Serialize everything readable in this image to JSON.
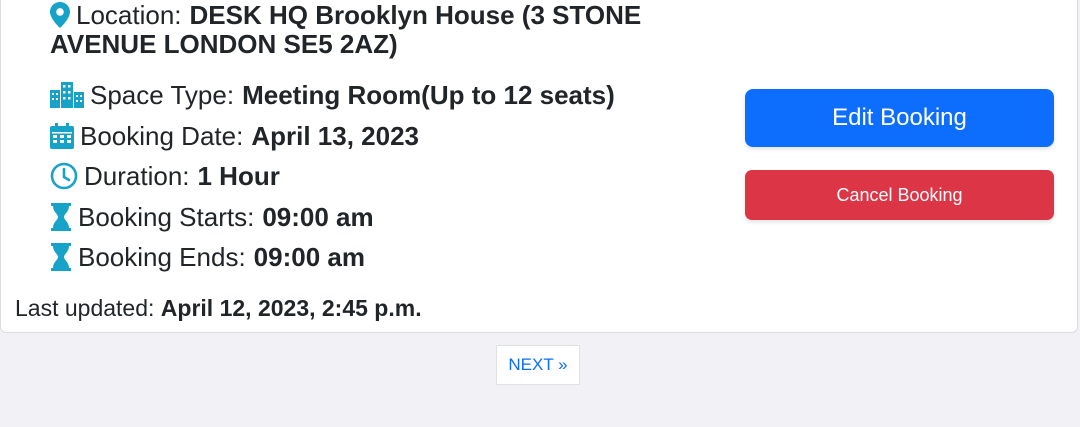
{
  "booking": {
    "location": {
      "icon": "map-pin-icon",
      "label": "Location:",
      "value_line1": "DESK HQ Brooklyn House (3 STONE",
      "value_line2": "AVENUE LONDON SE5 2AZ)"
    },
    "space_type": {
      "icon": "city-buildings-icon",
      "label": "Space Type:",
      "value": "Meeting Room(Up to 12 seats)"
    },
    "booking_date": {
      "icon": "calendar-icon",
      "label": "Booking Date:",
      "value": "April 13, 2023"
    },
    "duration": {
      "icon": "clock-icon",
      "label": "Duration:",
      "value": "1 Hour"
    },
    "starts": {
      "icon": "hourglass-icon",
      "label": "Booking Starts:",
      "value": "09:00 am"
    },
    "ends": {
      "icon": "hourglass-icon",
      "label": "Booking Ends:",
      "value": "09:00 am"
    }
  },
  "updated": {
    "label": "Last updated:",
    "value": "April 12, 2023, 2:45 p.m."
  },
  "actions": {
    "edit_label": "Edit Booking",
    "cancel_label": "Cancel Booking"
  },
  "pagination": {
    "next_label": "NEXT »"
  },
  "colors": {
    "icon": "#17a2c8",
    "primary": "#0d6efd",
    "danger": "#dc3545",
    "background": "#f2f1f6"
  }
}
